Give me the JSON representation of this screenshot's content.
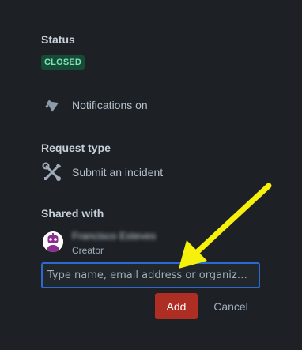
{
  "status": {
    "heading": "Status",
    "badge": "CLOSED"
  },
  "notifications": {
    "icon": "megaphone-icon",
    "label": "Notifications on"
  },
  "request_type": {
    "heading": "Request type",
    "icon": "wrench-screwdriver-icon",
    "label": "Submit an incident"
  },
  "shared_with": {
    "heading": "Shared with",
    "user": {
      "avatar_icon": "robot-avatar-icon",
      "name": "Francisco Esteves",
      "role": "Creator"
    },
    "input_placeholder": "Type name, email address or organiz…",
    "add_label": "Add",
    "cancel_label": "Cancel"
  },
  "colors": {
    "background": "#1d2125",
    "badge_bg": "#164b35",
    "badge_text": "#7ee2b8",
    "input_border": "#2b6bd1",
    "add_button": "#ae2e24",
    "arrow": "#f5f10a"
  }
}
